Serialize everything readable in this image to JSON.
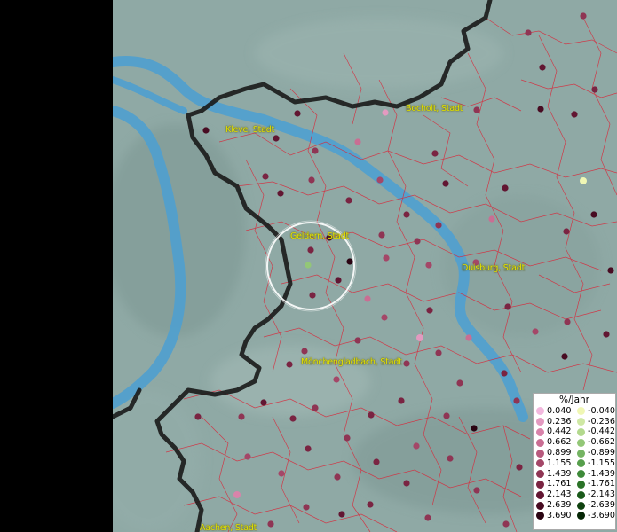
{
  "legend": {
    "title": "%/Jahr",
    "positive": [
      {
        "value": "0.040",
        "color": "#f2b8de"
      },
      {
        "value": "0.236",
        "color": "#e39ac0"
      },
      {
        "value": "0.442",
        "color": "#d883aa"
      },
      {
        "value": "0.662",
        "color": "#c96e93"
      },
      {
        "value": "0.899",
        "color": "#b85a7e"
      },
      {
        "value": "1.155",
        "color": "#a44768"
      },
      {
        "value": "1.439",
        "color": "#8f3554"
      },
      {
        "value": "1.761",
        "color": "#7a2442"
      },
      {
        "value": "2.143",
        "color": "#621632"
      },
      {
        "value": "2.639",
        "color": "#480c22"
      },
      {
        "value": "3.690",
        "color": "#2a0412"
      }
    ],
    "negative": [
      {
        "value": "-0.040",
        "color": "#f0f7b4"
      },
      {
        "value": "-0.236",
        "color": "#cfe8a4"
      },
      {
        "value": "-0.442",
        "color": "#b3d98e"
      },
      {
        "value": "-0.662",
        "color": "#93c777"
      },
      {
        "value": "-0.899",
        "color": "#75b463"
      },
      {
        "value": "-1.155",
        "color": "#579f4c"
      },
      {
        "value": "-1.439",
        "color": "#3e8a39"
      },
      {
        "value": "-1.761",
        "color": "#2b7328"
      },
      {
        "value": "-2.143",
        "color": "#1b5a1b"
      },
      {
        "value": "-2.639",
        "color": "#0f420f"
      },
      {
        "value": "-3.690",
        "color": "#062706"
      }
    ]
  },
  "cities": [
    {
      "name": "Bocholt, Stadt"
    },
    {
      "name": "Kleve, Stadt"
    },
    {
      "name": "Geldern, Stadt"
    },
    {
      "name": "Duisburg, Stadt"
    },
    {
      "name": "Mönchengladbach, Stadt"
    },
    {
      "name": "Aachen, Stadt"
    }
  ],
  "colors": {
    "map_background": "#8fa9a5",
    "river": "#4fa0d0",
    "district_lines": "#d8283a",
    "border": "#1a1a1a",
    "label": "#e6e600",
    "selection_circle": "#ffffff"
  }
}
